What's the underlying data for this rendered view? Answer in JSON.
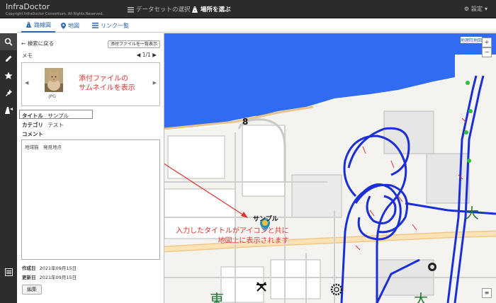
{
  "brand": {
    "name": "InfraDoctor",
    "copyright": "Copyright InfraDoctor Consortium. All Rights Reserved."
  },
  "nav": {
    "dataset": "データセットの選択",
    "place": "場所を選ぶ",
    "settings": "設定"
  },
  "tabs": [
    {
      "label": "路線図"
    },
    {
      "label": "地図"
    },
    {
      "label": "リンク一覧"
    }
  ],
  "panel": {
    "back": "検索に戻る",
    "attach_button": "添付ファイルを一覧表示",
    "memo_label": "メモ",
    "pager": "1/1",
    "thumb_ext": ".JPG",
    "annotation_thumb_line1": "添付ファイルの",
    "annotation_thumb_line2": "サムネイルを表示",
    "title_label": "タイトル",
    "title_value": "サンプル",
    "category_label": "カテゴリ",
    "category_value": "テスト",
    "comment_label": "コメント",
    "comment_value": "地域猫　発見地点",
    "created_label": "作成日",
    "created_value": "2021年09月15日",
    "updated_label": "更新日",
    "updated_value": "2021年09月15日",
    "edit_button": "編集"
  },
  "map": {
    "marker_label": "サンプル",
    "annotation_line1": "入力したタイトルがアイコンと共に",
    "annotation_line2": "地図上に表示されます",
    "credit": "地理院地図",
    "zoom_in": "+",
    "zoom_out": "−",
    "badge_num": "8",
    "kanji_left": "東",
    "kanji_right": "大",
    "kanji_far": "大"
  },
  "colors": {
    "topbar": "#2b2b2b",
    "accent": "#2a66a8",
    "annotation": "#e0302a",
    "route": "#1a2fd6",
    "water": "#2f6cf2"
  },
  "icons": [
    "search-icon",
    "pencil-icon",
    "star-icon",
    "pin-icon",
    "route-icon",
    "list-icon",
    "gear-icon",
    "map-pin-icon",
    "chevron-left-icon",
    "chevron-right-icon",
    "back-arrow-icon"
  ]
}
